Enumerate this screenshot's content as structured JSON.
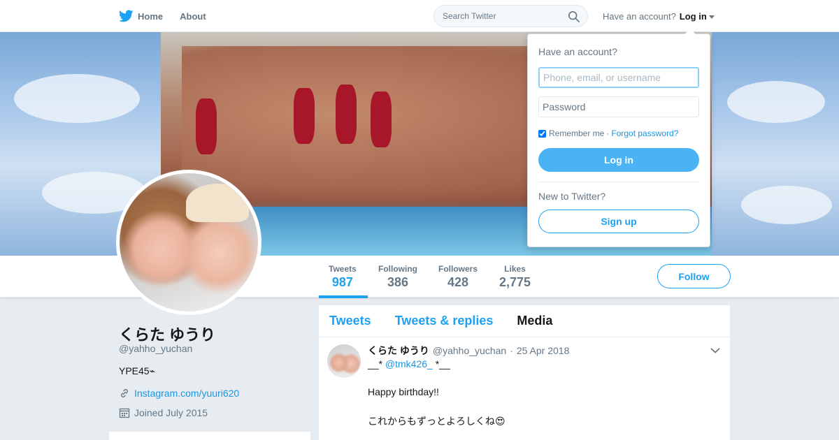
{
  "nav": {
    "home_label": "Home",
    "about_label": "About",
    "search_placeholder": "Search Twitter",
    "have_account": "Have an account?",
    "login_label": "Log in"
  },
  "profile": {
    "name": "くらた ゆうり",
    "handle": "@yahho_yuchan",
    "bio": "YPE45⌁",
    "link": "Instagram.com/yuuri620",
    "joined": "Joined July 2015"
  },
  "stats": [
    {
      "label": "Tweets",
      "value": "987"
    },
    {
      "label": "Following",
      "value": "386"
    },
    {
      "label": "Followers",
      "value": "428"
    },
    {
      "label": "Likes",
      "value": "2,775"
    }
  ],
  "follow_label": "Follow",
  "timeline": {
    "tabs": [
      "Tweets",
      "Tweets & replies",
      "Media"
    ],
    "tweet": {
      "name": "くらた ゆうり",
      "handle": "@yahho_yuchan",
      "date": "25 Apr 2018",
      "line1_prefix": "__*",
      "mention": "@tmk426_",
      "line1_suffix": "*__",
      "line2": "Happy birthday!!",
      "line3": "これからもずっとよろしくね😍"
    }
  },
  "login_dropdown": {
    "title": "Have an account?",
    "username_placeholder": "Phone, email, or username",
    "password_placeholder": "Password",
    "remember": "Remember me",
    "separator": "·",
    "forgot": "Forgot password?",
    "login_button": "Log in",
    "new_text": "New to Twitter?",
    "signup_button": "Sign up"
  },
  "colors": {
    "accent": "#1da1f2",
    "link": "#1b95e0",
    "login_button": "#4ab3f4",
    "background": "#e6ecf0"
  }
}
